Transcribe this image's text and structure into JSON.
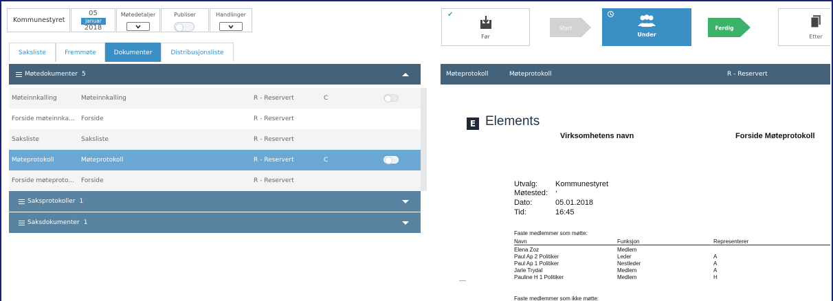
{
  "meeting": {
    "committee": "Kommunestyret",
    "date": {
      "day": "05",
      "month": "januar",
      "year": "2018"
    },
    "controls": [
      {
        "label": "Møtedetaljer",
        "type": "dropdown"
      },
      {
        "label": "Publiser",
        "type": "toggle"
      },
      {
        "label": "Handlinger",
        "type": "dropdown"
      }
    ]
  },
  "tabs": [
    {
      "label": "Saksliste",
      "active": false
    },
    {
      "label": "Fremmøte",
      "active": false
    },
    {
      "label": "Dokumenter",
      "active": true
    },
    {
      "label": "Distribusjonsliste",
      "active": false
    }
  ],
  "documents": {
    "group_main": {
      "label": "Møtedokumenter",
      "count": "5",
      "expanded": true
    },
    "rows": [
      {
        "name": "Møteinnkalling",
        "type": "Møteinnkalling",
        "access": "R - Reservert",
        "flag": "C",
        "toggle": true,
        "selected": false
      },
      {
        "name": "Forside møteinnka...",
        "type": "Forside",
        "access": "R - Reservert",
        "flag": "",
        "toggle": false,
        "selected": false
      },
      {
        "name": "Saksliste",
        "type": "Saksliste",
        "access": "R - Reservert",
        "flag": "",
        "toggle": false,
        "selected": false
      },
      {
        "name": "Møteprotokoll",
        "type": "Møteprotokoll",
        "access": "R - Reservert",
        "flag": "C",
        "toggle": true,
        "selected": true
      },
      {
        "name": "Forside møteproto...",
        "type": "Forside",
        "access": "R - Reservert",
        "flag": "",
        "toggle": false,
        "selected": false
      }
    ],
    "group_case_protocols": {
      "label": "Saksprotokoller",
      "count": "1"
    },
    "group_case_docs": {
      "label": "Saksdokumenter",
      "count": "1"
    }
  },
  "workflow": {
    "steps": [
      {
        "label": "Før",
        "state": "done",
        "icon": "download-icon"
      },
      {
        "label": "Start",
        "state": "inactive"
      },
      {
        "label": "Under",
        "state": "active",
        "icon": "people-icon"
      },
      {
        "label": "Ferdig",
        "state": "next"
      },
      {
        "label": "Etter",
        "state": "inactive",
        "icon": "documents-icon"
      }
    ]
  },
  "preview": {
    "header": {
      "name": "Møteprotokoll",
      "type": "Møteprotokoll",
      "access": "R - Reservert"
    },
    "logo": {
      "letter": "E",
      "text": "Elements"
    },
    "org_name": "Virksomhetens navn",
    "doc_title": "Forside Møteprotokoll",
    "fields": [
      {
        "key": "Utvalg:",
        "value": "Kommunestyret"
      },
      {
        "key": "Møtested:",
        "value": ","
      },
      {
        "key": "Dato:",
        "value": "05.01.2018"
      },
      {
        "key": "Tid:",
        "value": "16:45"
      }
    ],
    "attending_heading": "Faste medlemmer som møtte:",
    "columns": [
      "Navn",
      "Funksjon",
      "Representerer"
    ],
    "members": [
      {
        "name": "Elena Zoz",
        "role": "Medlem",
        "rep": ""
      },
      {
        "name": "Paul Ap 2 Politiker",
        "role": "Leder",
        "rep": "A"
      },
      {
        "name": "Paul Ap 1 Politiker",
        "role": "Nestleder",
        "rep": "A"
      },
      {
        "name": "Jarle Trydal",
        "role": "Medlem",
        "rep": "A"
      },
      {
        "name": "Pauline H 1 Politiker",
        "role": "Medlem",
        "rep": "H"
      }
    ],
    "absent_heading_partial": "Faste medlemmer som ikke møtte:"
  },
  "colors": {
    "accent": "#3a8fc5",
    "header_dark": "#44627a",
    "header_mid": "#5883a1",
    "selected_row": "#6aa7d3",
    "arrow_green": "#3bb16a"
  }
}
